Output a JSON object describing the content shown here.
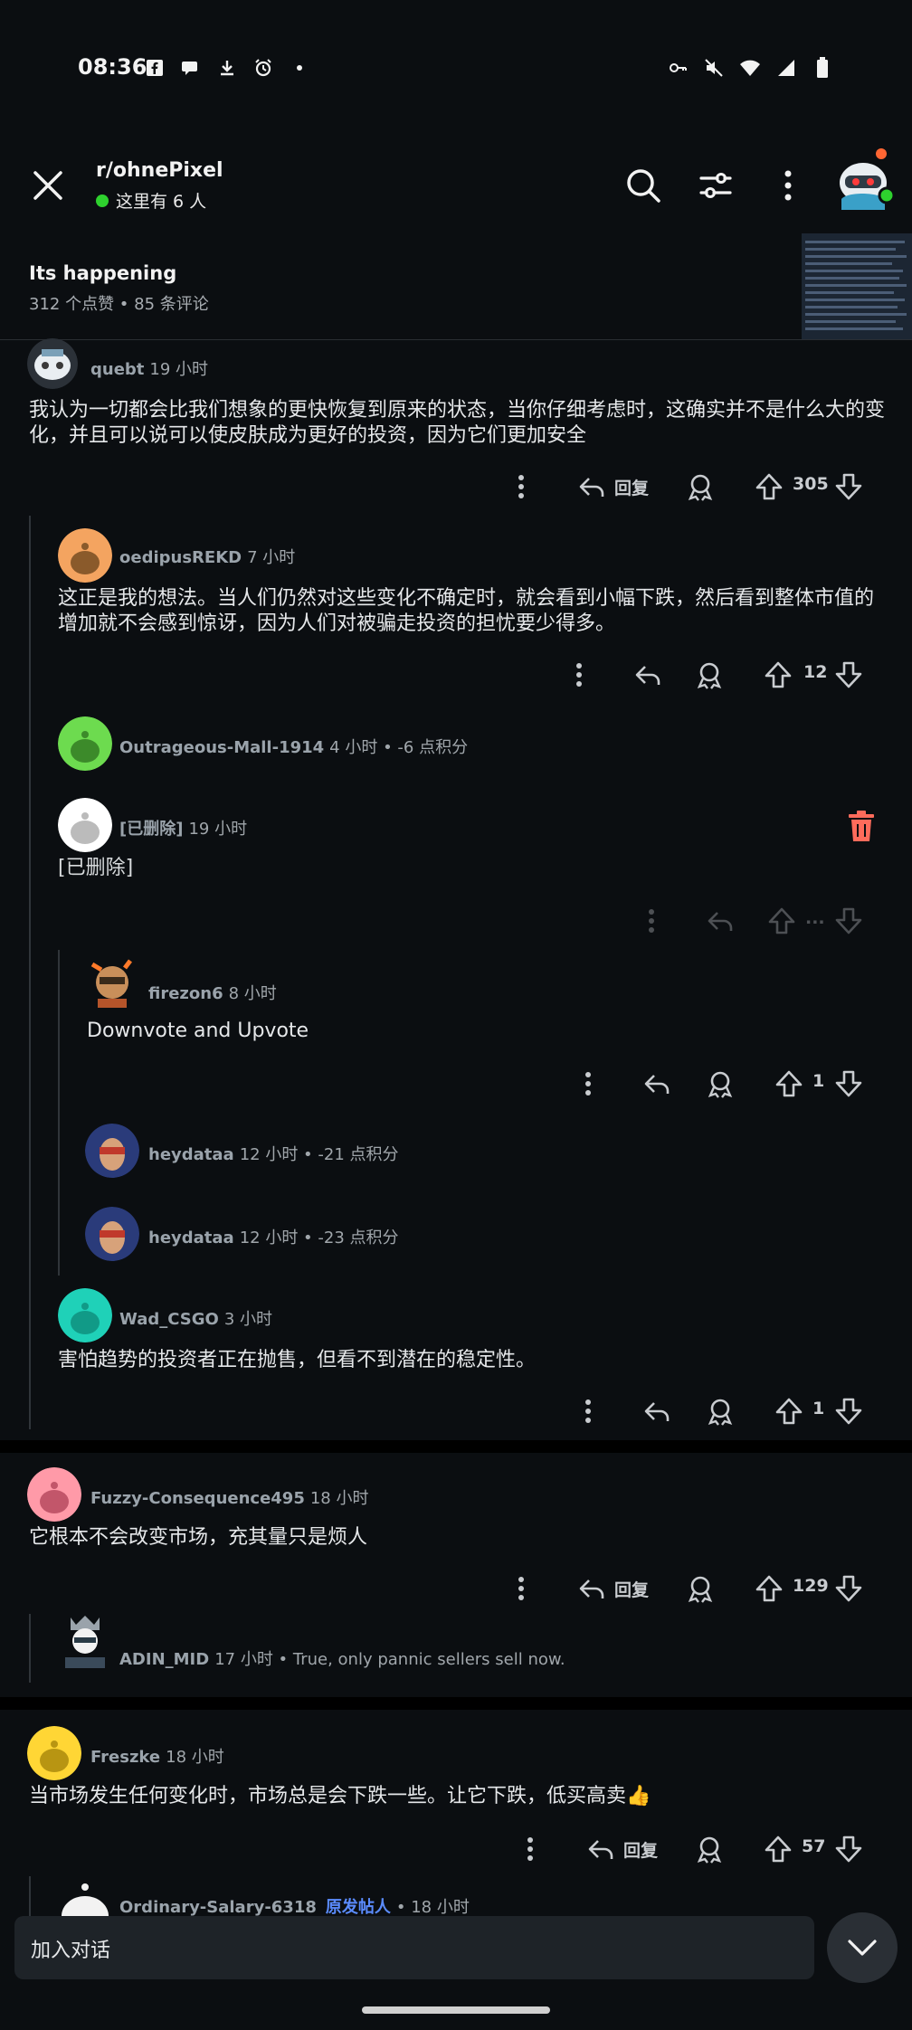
{
  "status_bar": {
    "time": "08:36"
  },
  "header": {
    "subreddit": "r/ohnePixel",
    "online": "这里有 6 人"
  },
  "post": {
    "title": "Its happening",
    "meta": "312 个点赞 • 85 条评论"
  },
  "comments": [
    {
      "user": "quebt",
      "time": "19 小时",
      "body": "我认为一切都会比我们想象的更快恢复到原来的状态，当你仔细考虑时，这确实并不是什么大的变化，并且可以说可以使皮肤成为更好的投资，因为它们更加安全",
      "reply": "回复",
      "score": "305"
    },
    {
      "user": "oedipusREKD",
      "time": "7 小时",
      "body": "这正是我的想法。当人们仍然对这些变化不确定时，就会看到小幅下跌，然后看到整体市值的增加就不会感到惊讶，因为人们对被骗走投资的担忧要少得多。",
      "score": "12"
    },
    {
      "user": "Outrageous-Mall-1914",
      "time": "4 小时 • -6 点积分"
    },
    {
      "user": "[已删除]",
      "time": "19 小时",
      "body": "[已删除]",
      "score": "..."
    },
    {
      "user": "firezon6",
      "time": "8 小时",
      "body": "Downvote and Upvote",
      "score": "1"
    },
    {
      "user": "heydataa",
      "time": "12 小时 • -21 点积分"
    },
    {
      "user": "heydataa",
      "time": "12 小时 • -23 点积分"
    },
    {
      "user": "Wad_CSGO",
      "time": "3 小时",
      "body": "害怕趋势的投资者正在抛售，但看不到潜在的稳定性。",
      "score": "1"
    },
    {
      "user": "Fuzzy-Consequence495",
      "time": "18 小时",
      "body": "它根本不会改变市场，充其量只是烦人",
      "reply": "回复",
      "score": "129"
    },
    {
      "user": "ADIN_MID",
      "time": "17 小时 • True, only pannic sellers sell now."
    },
    {
      "user": "Freszke",
      "time": "18 小时",
      "body": "当市场发生任何变化时，市场总是会下跌一些。让它下跌，低买高卖👍",
      "reply": "回复",
      "score": "57"
    },
    {
      "user": "Ordinary-Salary-6318",
      "op_badge": "原发帖人",
      "time": "• 18 小时"
    }
  ],
  "composer": {
    "placeholder": "加入对话"
  },
  "colors": {
    "online": "#2ed12e",
    "delete": "#ff6b5b",
    "op_badge": "#5b8cff"
  }
}
